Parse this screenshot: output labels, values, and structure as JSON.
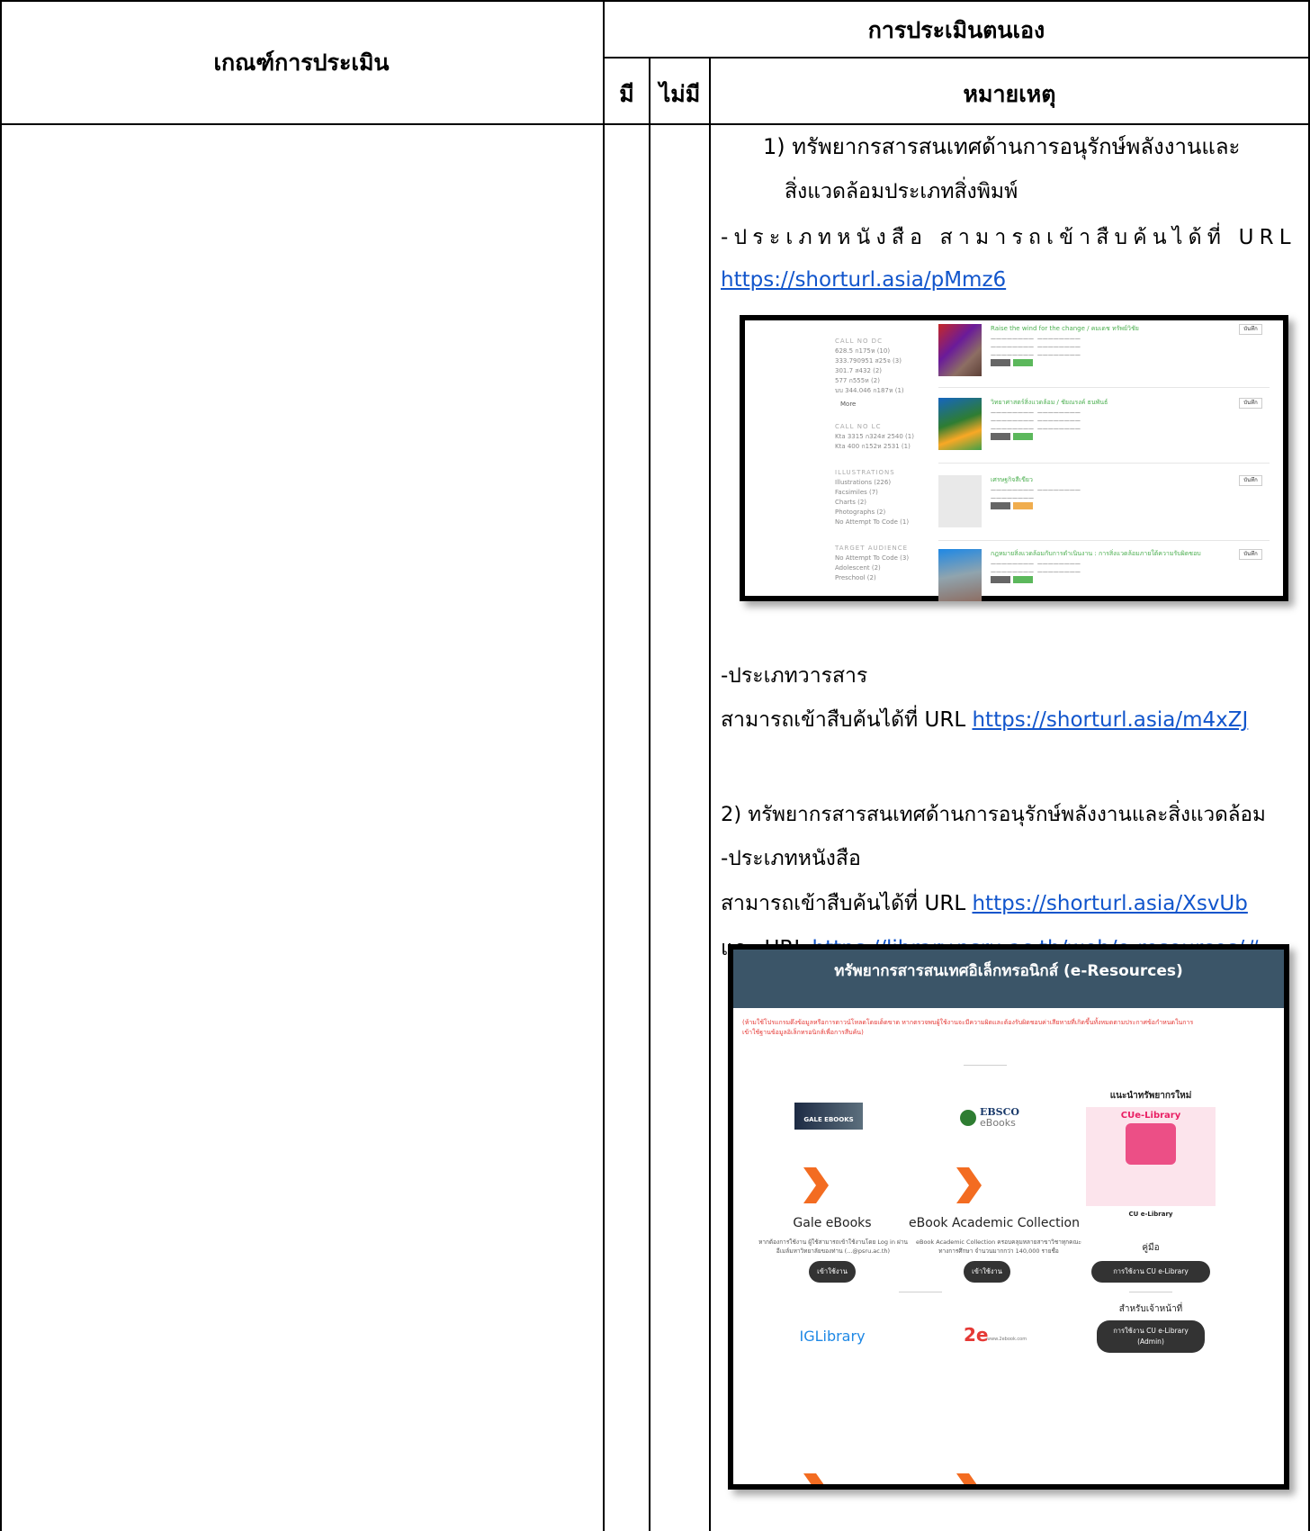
{
  "table": {
    "col_criteria": "เกณฑ์การประเมิน",
    "col_self_eval": "การประเมินตนเอง",
    "col_have": "มี",
    "col_not_have": "ไม่มี",
    "col_remarks": "หมายเหตุ"
  },
  "remarks": {
    "item1_line1": "1) ทรัพยากรสารสนเทศด้านการอนุรักษ์พลังงานและ",
    "item1_line2": "สิ่งแวดล้อมประเภทสิ่งพิมพ์",
    "book_search_text": "-ประเภทหนังสือ สามารถเข้าสืบค้นได้ที่ URL",
    "book_url": "https://shorturl.asia/pMmz6",
    "journal_label": "-ประเภทวารสาร",
    "journal_search_text": "สามารถเข้าสืบค้นได้ที่ URL",
    "journal_url": "https://shorturl.asia/m4xZJ",
    "item2_line1": "2) ทรัพยากรสารสนเทศด้านการอนุรักษ์พลังงานและสิ่งแวดล้อม",
    "item2_book_label": "-ประเภทหนังสือ",
    "item2_search_text": "สามารถเข้าสืบค้นได้ที่  URL",
    "item2_url1": "https://shorturl.asia/XsvUb",
    "item2_and": "และ URL",
    "item2_url2": "https://library.psru.ac.th/web/e-resources/#"
  },
  "screenshot1": {
    "sidebar": {
      "call_no_header": "CALL NO DC",
      "call_no_items": [
        "628.5 ก175ห (10)",
        "333.790951 ส25จ (3)",
        "301.7 ส432 (2)",
        "577 ก555ห (2)",
        "บบ 344.046 ก187ห (1)"
      ],
      "more": "More",
      "call_no_lc_header": "CALL NO LC",
      "call_no_lc_items": [
        "Kta 3315 ก324ส 2540 (1)",
        "Kta 400 ก152ห 2531 (1)"
      ],
      "illustrations_header": "ILLUSTRATIONS",
      "illustrations_items": [
        "Illustrations (226)",
        "Facsimiles (7)",
        "Charts (2)",
        "Photographs (2)",
        "No Attempt To Code (1)"
      ],
      "audience_header": "TARGET AUDIENCE",
      "audience_items": [
        "No Attempt To Code (3)",
        "Adolescent (2)",
        "Preschool (2)"
      ]
    },
    "results": [
      {
        "title": "Raise the wind for the change / คมเดช ทรัพย์วิชัย"
      },
      {
        "title": "วิทยาศาสตร์สิ่งแวดล้อม / ชัยณรงค์ ธนพันธ์"
      },
      {
        "title": "เศรษฐกิจสีเขียว"
      },
      {
        "title": "กฎหมายสิ่งแวดล้อมกับการดำเนินงาน : การสิ่งแวดล้อมภายใต้ความรับผิดชอบ"
      }
    ],
    "save_label": "บันทึก"
  },
  "screenshot2": {
    "banner": "ทรัพยากรสารสนเทศอิเล็กทรอนิกส์ (e-Resources)",
    "notice": "(ห้ามใช้โปรแกรมดึงข้อมูลหรือการดาวน์โหลดโดยเด็ดขาด หากตรวจพบผู้ใช้งานจะมีความผิดและต้องรับผิดชอบค่าเสียหายที่เกิดขึ้นทั้งหมดตามประกาศข้อกำหนดในการ\nเข้าใช้ฐานข้อมูลอิเล็กทรอนิกส์เพื่อการสืบค้น)",
    "gale_logo": "GALE EBOOKS",
    "ebsco_logo_1": "EBSCO",
    "ebsco_logo_2": "eBooks",
    "new_resources": "แนะนำทรัพยากรใหม่",
    "cu_logo": "CUe-Library",
    "cu_caption": "CU e-Library",
    "gale_name": "Gale eBooks",
    "gale_desc": "หากต้องการใช้งาน ผู้ใช้สามารถเข้าใช้งานโดย Log in ผ่าน\nอีเมล์มหาวิทยาลัยของท่าน (...@psru.ac.th)",
    "ebook_name": "eBook Academic Collection",
    "ebook_desc": "eBook Academic Collection ครอบคลุมหลายสาขาวิชาทุกคณะ\nทางการศึกษา จำนวนมากกว่า 140,000 รายชื่อ",
    "enter_label": "เข้าใช้งาน",
    "manual": "คู่มือ",
    "cu_use": "การใช้งาน CU e-Library",
    "for_staff": "สำหรับเจ้าหน้าที่",
    "cu_admin": "การใช้งาน CU e-Library\n(Admin)",
    "ig_logo": "IGLibrary",
    "twoe_site": "www.2ebook.com"
  },
  "colors": {
    "link": "#1155cc",
    "banner": "#3b5568",
    "accent_orange": "#f36c21"
  }
}
